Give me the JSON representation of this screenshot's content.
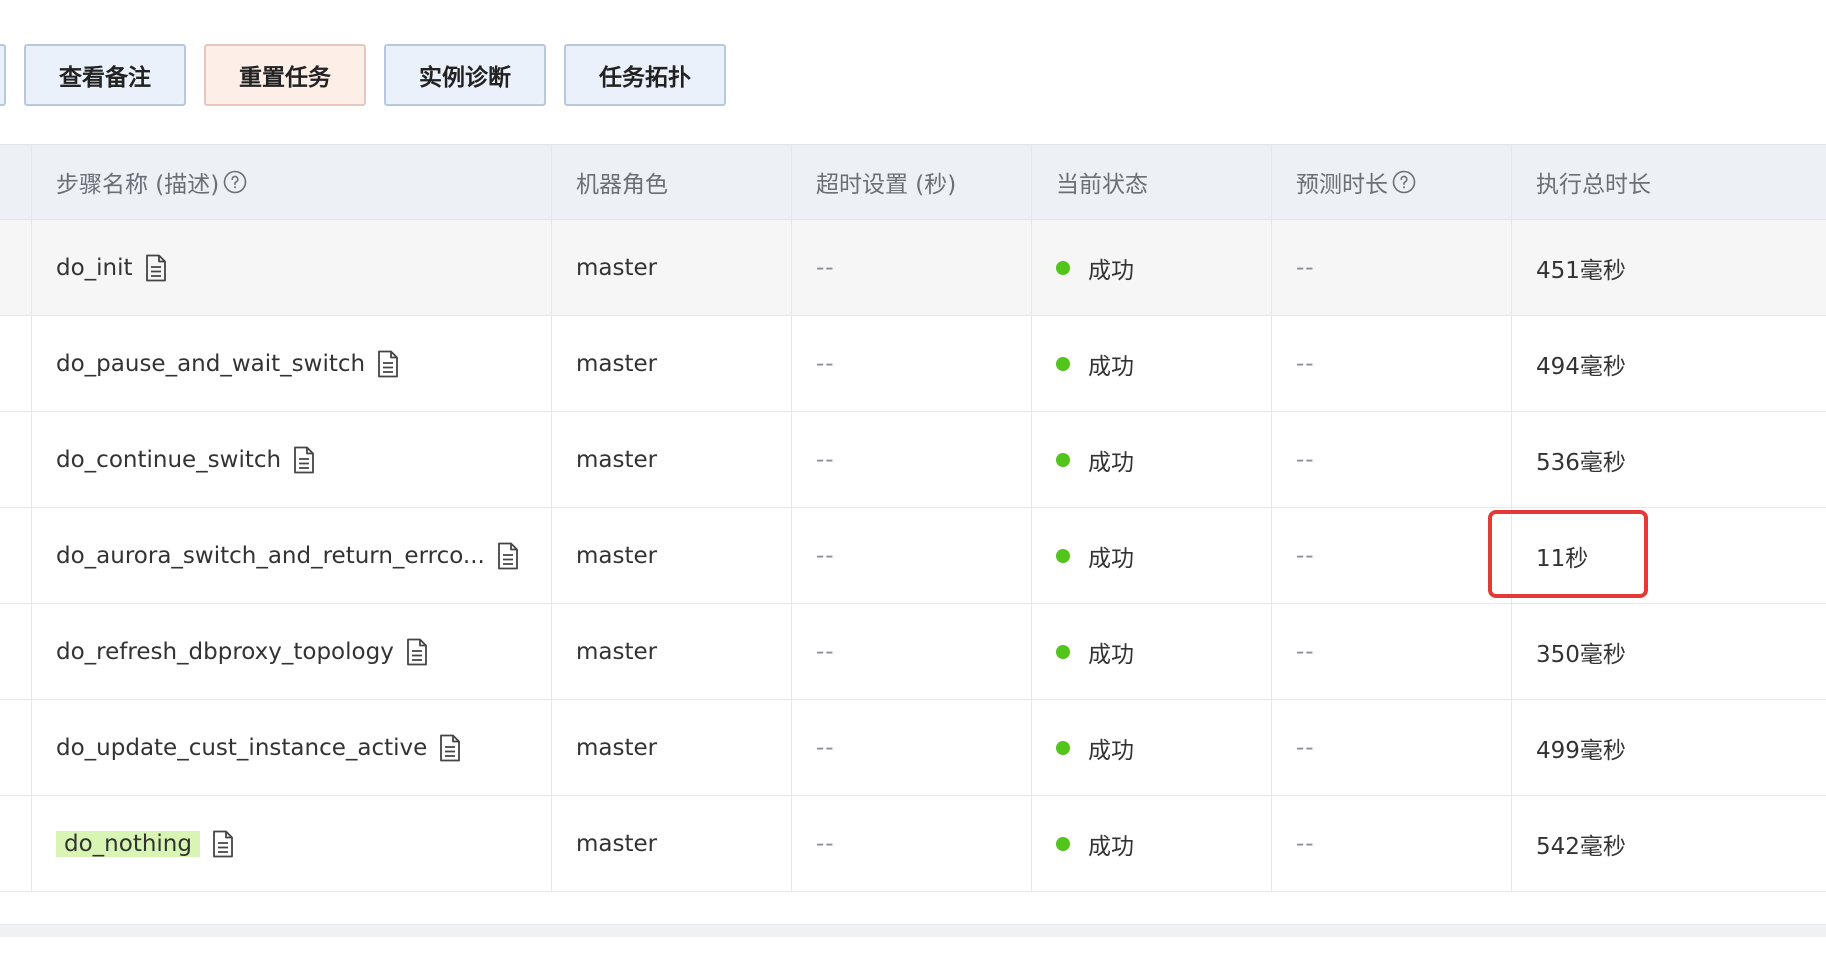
{
  "toolbar": {
    "buttons": [
      {
        "label": "查看备注"
      },
      {
        "label": "重置任务"
      },
      {
        "label": "实例诊断"
      },
      {
        "label": "任务拓扑"
      }
    ]
  },
  "table": {
    "headers": {
      "step_name": "步骤名称 (描述)",
      "machine_role": "机器角色",
      "timeout": "超时设置 (秒)",
      "status": "当前状态",
      "predicted_duration": "预测时长",
      "total_duration": "执行总时长"
    },
    "rows": [
      {
        "step_name": "do_init",
        "machine_role": "master",
        "timeout": "--",
        "status": "成功",
        "predicted": "--",
        "total": "451毫秒"
      },
      {
        "step_name": "do_pause_and_wait_switch",
        "machine_role": "master",
        "timeout": "--",
        "status": "成功",
        "predicted": "--",
        "total": "494毫秒"
      },
      {
        "step_name": "do_continue_switch",
        "machine_role": "master",
        "timeout": "--",
        "status": "成功",
        "predicted": "--",
        "total": "536毫秒"
      },
      {
        "step_name": "do_aurora_switch_and_return_errco...",
        "machine_role": "master",
        "timeout": "--",
        "status": "成功",
        "predicted": "--",
        "total": "11秒"
      },
      {
        "step_name": "do_refresh_dbproxy_topology",
        "machine_role": "master",
        "timeout": "--",
        "status": "成功",
        "predicted": "--",
        "total": "350毫秒"
      },
      {
        "step_name": "do_update_cust_instance_active",
        "machine_role": "master",
        "timeout": "--",
        "status": "成功",
        "predicted": "--",
        "total": "499毫秒"
      },
      {
        "step_name": "do_nothing",
        "machine_role": "master",
        "timeout": "--",
        "status": "成功",
        "predicted": "--",
        "total": "542毫秒"
      }
    ]
  },
  "colors": {
    "status_success": "#52c41a",
    "callout": "#e53935",
    "highlight": "#d8f5b4"
  },
  "icons": [
    "help-circle-icon",
    "document-icon",
    "status-dot-icon"
  ]
}
